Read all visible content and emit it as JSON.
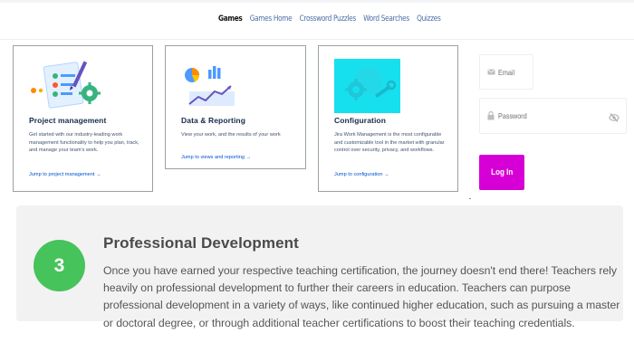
{
  "nav": {
    "items": [
      {
        "label": "Games",
        "active": true
      },
      {
        "label": "Games Home",
        "active": false
      },
      {
        "label": "Crossword Puzzles",
        "active": false
      },
      {
        "label": "Word Searches",
        "active": false
      },
      {
        "label": "Quizzes",
        "active": false
      }
    ]
  },
  "cards": [
    {
      "title": "Project management",
      "description": "Get started with our industry-leading work management functionality to help you plan, track, and manage your team's work.",
      "link": "Jump to project management →",
      "icon": "checklist-gear-illustration"
    },
    {
      "title": "Data & Reporting",
      "description": "View your work, and the results of your work",
      "link": "Jump to views and reporting →",
      "icon": "chart-report-illustration"
    },
    {
      "title": "Configuration",
      "description": "Jira Work Management is the most configurable and customizable tool in the market with granular control over security, privacy, and workflows.",
      "link": "Jump to configuration →",
      "icon": "gear-wrench-illustration"
    }
  ],
  "login": {
    "email_placeholder": "Email",
    "password_placeholder": "Password",
    "button_label": "Log In",
    "button_color": "#d600d6"
  },
  "professional_development": {
    "step_number": "3",
    "title": "Professional Development",
    "body": "Once you have earned your respective teaching certification, the journey doesn't end there! Teachers rely heavily on professional development to further their careers in education. Teachers can purpose professional development in a variety of ways, like continued higher education, such as pursuing a master or doctoral degree, or through additional teacher certifications to boost their teaching credentials.",
    "circle_color": "#46c35a"
  }
}
